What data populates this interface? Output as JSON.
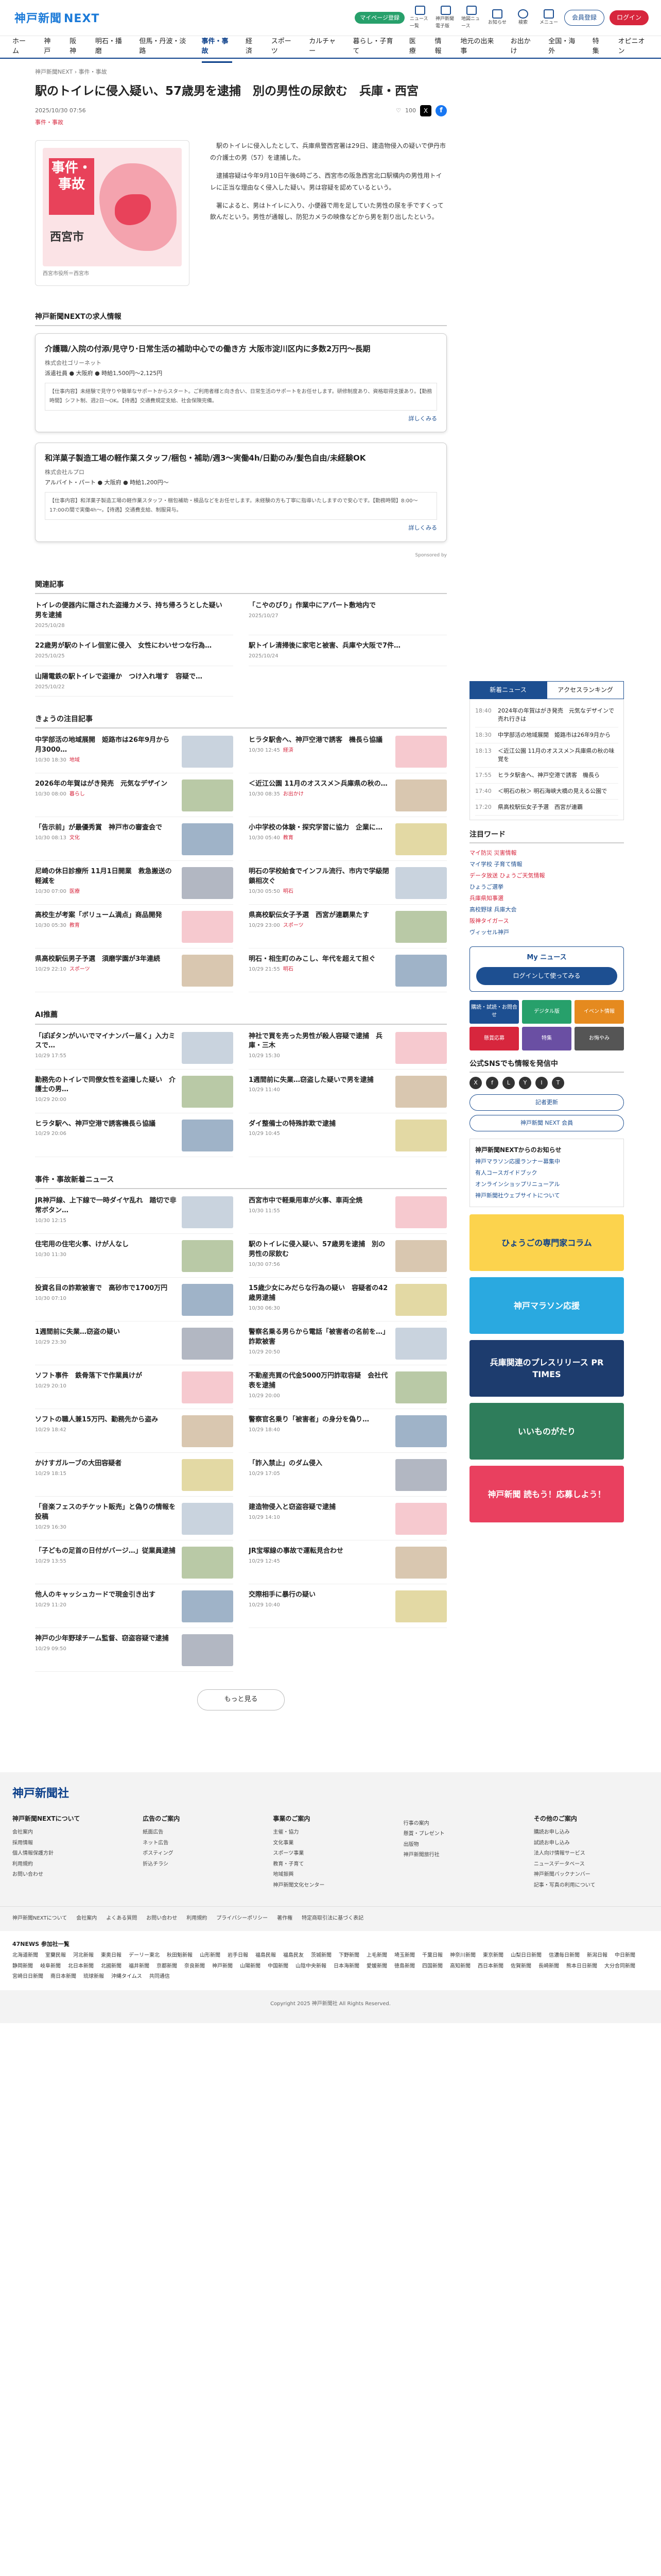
{
  "header": {
    "logo": "神戸新聞",
    "logo_sub": "NEXT",
    "green_pill": "マイページ登録",
    "icons": [
      "ニュース一覧",
      "神戸新聞電子版",
      "地図ニュース",
      "お知らせ",
      "検索",
      "メニュー"
    ],
    "register": "会員登録",
    "login": "ログイン"
  },
  "nav": [
    "ホーム",
    "神戸",
    "阪神",
    "明石・播磨",
    "但馬・丹波・淡路",
    "事件・事故",
    "経済",
    "スポーツ",
    "カルチャー",
    "暮らし・子育て",
    "医療",
    "情報",
    "地元の出来事",
    "お出かけ",
    "全国・海外",
    "特集",
    "オピニオン"
  ],
  "article": {
    "breadcrumb": "神戸新聞NEXT › 事件・事故",
    "headline": "駅のトイレに侵入疑い、57歳男を逮捕　別の男性の尿飲む　兵庫・西宮",
    "date": "2025/10/30 07:56",
    "category": "事件・事故",
    "share_count": "100",
    "photo_label": "事件・事故",
    "photo_city": "西宮市",
    "caption": "西宮市役所＝西宮市",
    "body": [
      "駅のトイレに侵入したとして、兵庫県警西宮署は29日、建造物侵入の疑いで伊丹市の介護士の男（57）を逮捕した。",
      "逮捕容疑は今年9月10日午後6時ごろ、西宮市の阪急西宮北口駅構内の男性用トイレに正当な理由なく侵入した疑い。男は容疑を認めているという。",
      "署によると、男はトイレに入り、小便器で用を足していた男性の尿を手ですくって飲んだという。男性が通報し、防犯カメラの映像などから男を割り出したという。"
    ]
  },
  "jobs": {
    "section_title": "神戸新聞NEXTの求人情報",
    "items": [
      {
        "title": "介護職/入院の付添/見守り·日常生活の補助中心での働き方 大阪市淀川区内に多数2万円〜長期",
        "company": "株式会社ゴリーネット",
        "cond": "派遣社員 ● 大阪府 ● 時給1,500円〜2,125円",
        "desc": "【仕事内容】未経験で見守りや簡単なサポートからスタート。ご利用者様と向き合い、日常生活のサポートをお任せします。研修制度あり、資格取得支援あり。【勤務時間】シフト制、週2日〜OK。【待遇】交通費規定支給、社会保険完備。",
        "more": "詳しくみる"
      },
      {
        "title": "和洋菓子製造工場の軽作業スタッフ/梱包・補助/週3〜実働4h/日勤のみ/髪色自由/未経験OK",
        "company": "株式会社ルプロ",
        "cond": "アルバイト・パート ● 大阪府 ● 時給1,200円〜",
        "desc": "【仕事内容】和洋菓子製造工場の軽作業スタッフ・梱包補助・検品などをお任せします。未経験の方も丁寧に指導いたしますので安心です。【勤務時間】8:00〜17:00の間で実働4h〜。【待遇】交通費支給、制服貸与。",
        "more": "詳しくみる"
      }
    ],
    "sponsored": "Sponsored by"
  },
  "related": {
    "title": "関連記事",
    "items": [
      {
        "t": "トイレの便器内に隠された盗撮カメラ、持ち帰ろうとした疑い　男を逮捕",
        "d": "2025/10/28"
      },
      {
        "t": "「こやのびり」作業中にアパート敷地内で",
        "d": "2025/10/27"
      },
      {
        "t": "22歳男が駅のトイレ個室に侵入　女性にわいせつな行為…",
        "d": "2025/10/25"
      },
      {
        "t": "駅トイレ清掃後に家宅と被害、兵庫や大阪で7件…",
        "d": "2025/10/24"
      },
      {
        "t": "山陽電鉄の駅トイレで盗撮か　つけ入れ増す　容疑で…",
        "d": "2025/10/22"
      }
    ]
  },
  "recommend": {
    "title": "きょうの注目記事",
    "items": [
      {
        "t": "中学部活の地域展開　姫路市は26年9月から　月3000…",
        "d": "10/30 18:30",
        "c": "地域"
      },
      {
        "t": "ヒラタ駅舎へ、神戸空港で誘客　機長ら協議",
        "d": "10/30 12:45",
        "c": "経済"
      },
      {
        "t": "2026年の年賀はがき発売　元気なデザイン",
        "d": "10/30 08:00",
        "c": "暮らし"
      },
      {
        "t": "＜近江公園 11月のオススメ＞兵庫県の秋の…",
        "d": "10/30 08:35",
        "c": "お出かけ"
      },
      {
        "t": "「告示前」が最優秀賞　神戸市の審査会で",
        "d": "10/30 08:13",
        "c": "文化"
      },
      {
        "t": "小中学校の体験・探究学習に協力　企業に…",
        "d": "10/30 05:40",
        "c": "教育"
      },
      {
        "t": "尼崎の休日診療所 11月1日開業　救急搬送の軽減を",
        "d": "10/30 07:00",
        "c": "医療"
      },
      {
        "t": "明石の学校給食でインフル流行、市内で学級閉鎖相次ぐ",
        "d": "10/30 05:50",
        "c": "明石"
      },
      {
        "t": "高校生が考案「ボリューム満点」商品開発",
        "d": "10/30 05:30",
        "c": "教育"
      },
      {
        "t": "県高校駅伝女子予選　西宮が連覇果たす",
        "d": "10/29 23:00",
        "c": "スポーツ"
      },
      {
        "t": "県高校駅伝男子予選　須磨学園が3年連続",
        "d": "10/29 22:10",
        "c": "スポーツ"
      },
      {
        "t": "明石・相生町のみこし、年代を超えて担ぐ",
        "d": "10/29 21:55",
        "c": "明石"
      }
    ]
  },
  "ai": {
    "title": "AI推薦",
    "items": [
      {
        "t": "「ぽぽタンがいいでマイナンバー届く」入力ミスで…",
        "d": "10/29 17:55"
      },
      {
        "t": "神社で買を売った男性が殺人容疑で逮捕　兵庫・三木",
        "d": "10/29 15:30"
      },
      {
        "t": "勤務先のトイレで同僚女性を盗撮した疑い　介護士の男…",
        "d": "10/29 20:00"
      },
      {
        "t": "1週間前に失業…窃盗した疑いで男を逮捕",
        "d": "10/29 11:40"
      },
      {
        "t": "ヒラタ駅へ、神戸空港で誘客機長ら協議",
        "d": "10/29 20:06"
      },
      {
        "t": "ダイ整備士の特殊詐欺で逮捕",
        "d": "10/29 10:45"
      }
    ]
  },
  "incidents": {
    "title": "事件・事故新着ニュース",
    "items": [
      {
        "t": "JR神戸線、上下線で一時ダイヤ乱れ　踏切で非常ボタン…",
        "d": "10/30 12:15"
      },
      {
        "t": "西宮市中で軽乗用車が火事、車両全焼",
        "d": "10/30 11:55"
      },
      {
        "t": "住宅用の住宅火事、けが人なし",
        "d": "10/30 11:30"
      },
      {
        "t": "駅のトイレに侵入疑い、57歳男を逮捕　別の男性の尿飲む",
        "d": "10/30 07:56"
      },
      {
        "t": "投資名目の詐欺被害で　高砂市で1700万円",
        "d": "10/30 07:10"
      },
      {
        "t": "15歳少女にみだらな行為の疑い　容疑者の42歳男逮捕",
        "d": "10/30 06:30"
      },
      {
        "t": "1週間前に失業…窃盗の疑い",
        "d": "10/29 23:30"
      },
      {
        "t": "警察名乗る男らから電話「被害者の名前を…」詐欺被害",
        "d": "10/29 20:50"
      },
      {
        "t": "ソフト事件　鉄骨落下で作業員けが",
        "d": "10/29 20:10"
      },
      {
        "t": "不動産売買の代金5000万円詐取容疑　会社代表を逮捕",
        "d": "10/29 20:00"
      },
      {
        "t": "ソフトの職人兼15万円、勤務先から盗み",
        "d": "10/29 18:42"
      },
      {
        "t": "警察官名乗り「被害者」の身分を偽り…",
        "d": "10/29 18:40"
      },
      {
        "t": "かけすガルーブの大田容疑者",
        "d": "10/29 18:15"
      },
      {
        "t": "「詐入禁止」のダム侵入",
        "d": "10/29 17:05"
      },
      {
        "t": "「音楽フェスのチケット販売」と偽りの情報を投稿",
        "d": "10/29 16:30"
      },
      {
        "t": "建造物侵入と窃盗容疑で逮捕",
        "d": "10/29 14:10"
      },
      {
        "t": "「子どもの足首の日付がバージ…」従業員逮捕",
        "d": "10/29 13:55"
      },
      {
        "t": "JR宝塚線の事故で運転見合わせ",
        "d": "10/29 12:45"
      },
      {
        "t": "他人のキャッシュカードで現金引き出す",
        "d": "10/29 11:20"
      },
      {
        "t": "交際相手に暴行の疑い",
        "d": "10/29 10:40"
      },
      {
        "t": "神戸の少年野球チーム監督、窃盗容疑で逮捕",
        "d": "10/29 09:50"
      }
    ],
    "more": "もっと見る"
  },
  "side": {
    "tab_on": "新着ニュース",
    "tab_off": "アクセスランキング",
    "ranking": [
      {
        "tm": "18:40",
        "t": "2024年の年賀はがき発売　元気なデザインで売れ行きは"
      },
      {
        "tm": "18:30",
        "t": "中学部活の地域展開　姫路市は26年9月から"
      },
      {
        "tm": "18:13",
        "t": "＜近江公園 11月のオススメ＞兵庫県の秋の味覚を"
      },
      {
        "tm": "17:55",
        "t": "ヒラタ駅舎へ、神戸空港で誘客　機長ら"
      },
      {
        "tm": "17:40",
        "t": "＜明石の秋＞ 明石海峡大橋の見える公園で"
      },
      {
        "tm": "17:20",
        "t": "県高校駅伝女子予選　西宮が連覇"
      }
    ],
    "keywords_title": "注目ワード",
    "keywords": [
      "マイ防災 災害情報",
      "マイ学校 子育て情報",
      "データ放送 ひょうご天気情報",
      "ひょうご選挙",
      "兵庫県知事選",
      "高校野球 兵庫大会",
      "阪神タイガース",
      "ヴィッセル神戸"
    ],
    "mynews_title": "My ニュース",
    "mynews_btn": "ログインして使ってみる",
    "services": [
      {
        "label": "購読・試読・お問合せ",
        "color": "#1d4f91"
      },
      {
        "label": "デジタル版",
        "color": "#27a06b"
      },
      {
        "label": "イベント情報",
        "color": "#e58a1f"
      },
      {
        "label": "懸賞応募",
        "color": "#d7263d"
      },
      {
        "label": "特集",
        "color": "#6a4fa3"
      },
      {
        "label": "お悔やみ",
        "color": "#555555"
      }
    ],
    "sns_title": "公式SNSでも情報を発信中",
    "sns": [
      "X",
      "f",
      "L",
      "Y",
      "I",
      "T"
    ],
    "btn1": "記者更新",
    "btn2": "神戸新聞 NEXT 会員",
    "notice_title": "神戸新聞NEXTからのお知らせ",
    "notices": [
      "神戸マラソン応援ランナー募集中",
      "有人コースガイドブック",
      "オンラインショップリニューアル",
      "神戸新聞社ウェブサイトについて"
    ],
    "banners": [
      {
        "t": "ひょうごの専門家コラム",
        "bg": "#fcd34d",
        "fg": "#0b3f8a"
      },
      {
        "t": "神戸マラソン応援",
        "bg": "#2aa9e0",
        "fg": "#ffffff"
      },
      {
        "t": "兵庫関連のプレスリリース PR TIMES",
        "bg": "#1d3c6e",
        "fg": "#ffffff"
      },
      {
        "t": "いいものがたり",
        "bg": "#2e7d5b",
        "fg": "#ffffff"
      },
      {
        "t": "神戸新聞 読もう！応募しよう！",
        "bg": "#e9405f",
        "fg": "#ffffff"
      }
    ]
  },
  "footer": {
    "logo": "神戸新聞社",
    "cols": [
      {
        "h": "神戸新聞NEXTについて",
        "items": [
          "会社案内",
          "採用情報",
          "個人情報保護方針",
          "利用規約",
          "お問い合わせ"
        ]
      },
      {
        "h": "広告のご案内",
        "items": [
          "紙面広告",
          "ネット広告",
          "ポスティング",
          "折込チラシ"
        ]
      },
      {
        "h": "事業のご案内",
        "items": [
          "主催・協力",
          "文化事業",
          "スポーツ事業",
          "教育・子育て",
          "地域振興",
          "神戸新聞文化センター"
        ]
      },
      {
        "h": "",
        "items": [
          "行事の案内",
          "懸賞・プレゼント",
          "出版物",
          "神戸新聞旅行社"
        ]
      },
      {
        "h": "その他のご案内",
        "items": [
          "購読お申し込み",
          "試読お申し込み",
          "法人向け情報サービス",
          "ニュースデータベース",
          "神戸新聞バックナンバー",
          "記事・写真の利用について"
        ]
      }
    ],
    "bar": [
      "神戸新聞NEXTについて",
      "会社案内",
      "よくある質問",
      "お問い合わせ",
      "利用規約",
      "プライバシーポリシー",
      "著作権",
      "特定商取引法に基づく表記"
    ],
    "f47_title": "47NEWS 参加社一覧",
    "f47": [
      "北海道新聞",
      "室蘭民報",
      "河北新報",
      "東奥日報",
      "デーリー東北",
      "秋田魁新報",
      "山形新聞",
      "岩手日報",
      "福島民報",
      "福島民友",
      "茨城新聞",
      "下野新聞",
      "上毛新聞",
      "埼玉新聞",
      "千葉日報",
      "神奈川新聞",
      "東京新聞",
      "山梨日日新聞",
      "信濃毎日新聞",
      "新潟日報",
      "中日新聞",
      "静岡新聞",
      "岐阜新聞",
      "北日本新聞",
      "北國新聞",
      "福井新聞",
      "京都新聞",
      "奈良新聞",
      "神戸新聞",
      "山陽新聞",
      "中国新聞",
      "山陰中央新報",
      "日本海新聞",
      "愛媛新聞",
      "徳島新聞",
      "四国新聞",
      "高知新聞",
      "西日本新聞",
      "佐賀新聞",
      "長崎新聞",
      "熊本日日新聞",
      "大分合同新聞",
      "宮崎日日新聞",
      "南日本新聞",
      "琉球新報",
      "沖縄タイムス",
      "共同通信"
    ],
    "copyright": "Copyright 2025 神戸新聞社 All Rights Reserved."
  }
}
